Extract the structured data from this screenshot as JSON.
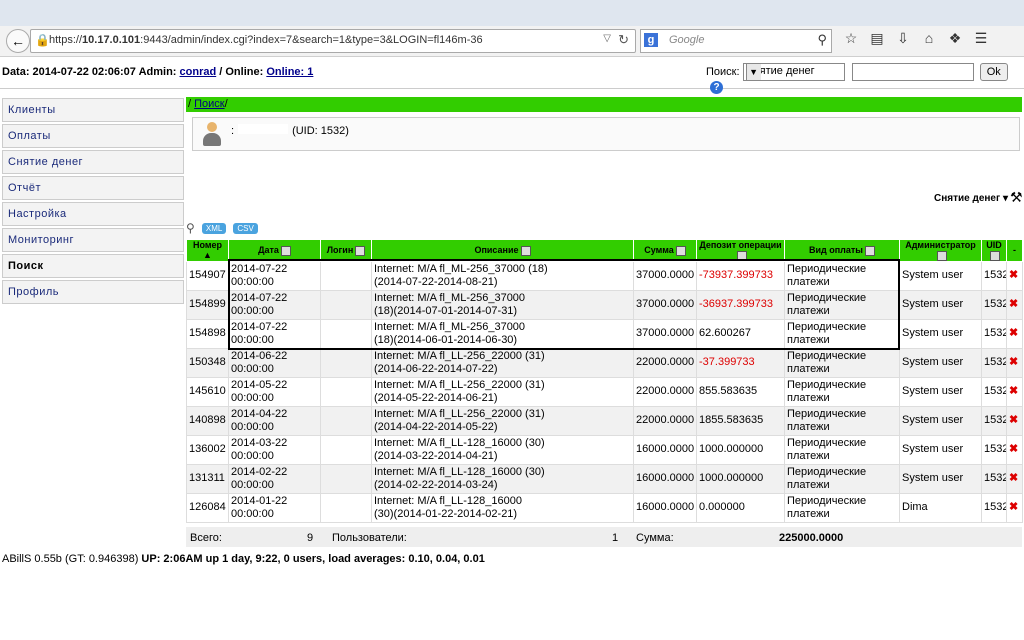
{
  "browser": {
    "url_prefix": "https://",
    "url_host": "10.17.0.101",
    "url_rest": ":9443/admin/index.cgi?index=7&search=1&type=3&LOGIN=fl146m-36",
    "search_placeholder": "Google",
    "search_engine_letter": "g"
  },
  "topinfo": {
    "date_label": "Data: 2014-07-22 02:06:07 Admin:",
    "admin_name": "conrad",
    "online_label": "/ Online:",
    "online_link": "Online: 1",
    "search_label": "Поиск:",
    "search_type": "Снятие денег",
    "ok_label": "Ok",
    "help": "?"
  },
  "sidebar": {
    "items": [
      {
        "label": "Клиенты"
      },
      {
        "label": "Оплаты"
      },
      {
        "label": "Снятие денег"
      },
      {
        "label": "Отчёт"
      },
      {
        "label": "Настройка"
      },
      {
        "label": "Мониторинг"
      },
      {
        "label": "Поиск"
      },
      {
        "label": "Профиль"
      }
    ]
  },
  "breadcrumb": {
    "pre": "/ ",
    "link": "Поиск",
    "post": "/"
  },
  "user": {
    "prefix": ":",
    "uid": "(UID: 1532)"
  },
  "action_title": "Снятие денег",
  "exports": {
    "xml": "XML",
    "csv": "CSV"
  },
  "table": {
    "headers": [
      "Номер",
      "Дата",
      "Логин",
      "Описание",
      "Сумма",
      "Депозит операции",
      "Вид оплаты",
      "Администратор",
      "UID",
      "-"
    ],
    "rows": [
      {
        "num": "154907",
        "date1": "2014-07-22",
        "date2": "00:00:00",
        "desc1": "Internet: M/A fl_ML-256_37000 (18)",
        "desc2": "(2014-07-22-2014-08-21)",
        "sum": "37000.0000",
        "dep": "-73937.399733",
        "neg": true,
        "type1": "Периодические",
        "type2": "платежи",
        "admin": "System user",
        "uid": "1532"
      },
      {
        "num": "154899",
        "date1": "2014-07-22",
        "date2": "00:00:00",
        "desc1": "Internet: M/A fl_ML-256_37000",
        "desc2": "(18)(2014-07-01-2014-07-31)",
        "sum": "37000.0000",
        "dep": "-36937.399733",
        "neg": true,
        "type1": "Периодические",
        "type2": "платежи",
        "admin": "System user",
        "uid": "1532"
      },
      {
        "num": "154898",
        "date1": "2014-07-22",
        "date2": "00:00:00",
        "desc1": "Internet: M/A fl_ML-256_37000",
        "desc2": "(18)(2014-06-01-2014-06-30)",
        "sum": "37000.0000",
        "dep": "62.600267",
        "neg": false,
        "type1": "Периодические",
        "type2": "платежи",
        "admin": "System user",
        "uid": "1532"
      },
      {
        "num": "150348",
        "date1": "2014-06-22",
        "date2": "00:00:00",
        "desc1": "Internet: M/A fl_LL-256_22000 (31)",
        "desc2": "(2014-06-22-2014-07-22)",
        "sum": "22000.0000",
        "dep": "-37.399733",
        "neg": true,
        "type1": "Периодические",
        "type2": "платежи",
        "admin": "System user",
        "uid": "1532"
      },
      {
        "num": "145610",
        "date1": "2014-05-22",
        "date2": "00:00:00",
        "desc1": "Internet: M/A fl_LL-256_22000 (31)",
        "desc2": "(2014-05-22-2014-06-21)",
        "sum": "22000.0000",
        "dep": "855.583635",
        "neg": false,
        "type1": "Периодические",
        "type2": "платежи",
        "admin": "System user",
        "uid": "1532"
      },
      {
        "num": "140898",
        "date1": "2014-04-22",
        "date2": "00:00:00",
        "desc1": "Internet: M/A fl_LL-256_22000 (31)",
        "desc2": "(2014-04-22-2014-05-22)",
        "sum": "22000.0000",
        "dep": "1855.583635",
        "neg": false,
        "type1": "Периодические",
        "type2": "платежи",
        "admin": "System user",
        "uid": "1532"
      },
      {
        "num": "136002",
        "date1": "2014-03-22",
        "date2": "00:00:00",
        "desc1": "Internet: M/A fl_LL-128_16000 (30)",
        "desc2": "(2014-03-22-2014-04-21)",
        "sum": "16000.0000",
        "dep": "1000.000000",
        "neg": false,
        "type1": "Периодические",
        "type2": "платежи",
        "admin": "System user",
        "uid": "1532"
      },
      {
        "num": "131311",
        "date1": "2014-02-22",
        "date2": "00:00:00",
        "desc1": "Internet: M/A fl_LL-128_16000 (30)",
        "desc2": "(2014-02-22-2014-03-24)",
        "sum": "16000.0000",
        "dep": "1000.000000",
        "neg": false,
        "type1": "Периодические",
        "type2": "платежи",
        "admin": "System user",
        "uid": "1532"
      },
      {
        "num": "126084",
        "date1": "2014-01-22",
        "date2": "00:00:00",
        "desc1": "Internet: M/A fl_LL-128_16000",
        "desc2": "(30)(2014-01-22-2014-02-21)",
        "sum": "16000.0000",
        "dep": "0.000000",
        "neg": false,
        "type1": "Периодические",
        "type2": "платежи",
        "admin": "Dima",
        "uid": "1532"
      }
    ]
  },
  "totals": {
    "all_label": "Всего:",
    "all_val": "9",
    "users_label": "Пользователи:",
    "users_val": "1",
    "sum_label": "Сумма:",
    "sum_val": "225000.0000"
  },
  "footer": {
    "version": "ABillS 0.55b (GT: 0.946398)",
    "uptime": "UP: 2:06AM up 1 day, 9:22, 0 users, load averages: 0.10, 0.04, 0.01"
  }
}
